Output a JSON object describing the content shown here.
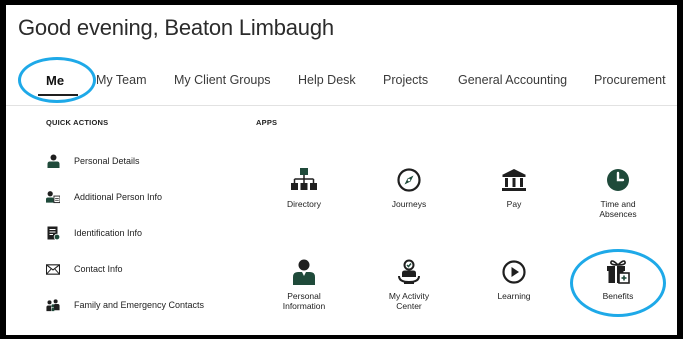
{
  "greeting": "Good evening, Beaton Limbaugh",
  "tabs": [
    {
      "label": "Me",
      "active": true
    },
    {
      "label": "My Team"
    },
    {
      "label": "My Client Groups"
    },
    {
      "label": "Help Desk"
    },
    {
      "label": "Projects"
    },
    {
      "label": "General Accounting"
    },
    {
      "label": "Procurement"
    }
  ],
  "quick_actions": {
    "title": "QUICK ACTIONS",
    "items": [
      {
        "label": "Personal Details",
        "icon": "person-icon"
      },
      {
        "label": "Additional Person Info",
        "icon": "person-card-icon"
      },
      {
        "label": "Identification Info",
        "icon": "id-document-icon"
      },
      {
        "label": "Contact Info",
        "icon": "envelope-icon"
      },
      {
        "label": "Family and Emergency Contacts",
        "icon": "family-icon"
      }
    ]
  },
  "apps": {
    "title": "APPS",
    "items": [
      {
        "label": "Directory",
        "icon": "org-chart-icon"
      },
      {
        "label": "Journeys",
        "icon": "compass-icon"
      },
      {
        "label": "Pay",
        "icon": "bank-icon"
      },
      {
        "label": "Time and\nAbsences",
        "icon": "clock-icon"
      },
      {
        "label": "Personal\nInformation",
        "icon": "person-icon"
      },
      {
        "label": "My Activity\nCenter",
        "icon": "activity-center-icon"
      },
      {
        "label": "Learning",
        "icon": "play-icon"
      },
      {
        "label": "Benefits",
        "icon": "gift-icon"
      }
    ]
  },
  "colors": {
    "highlight_circle": "#1ea9e8",
    "icon_dark": "#1f4a3a"
  }
}
